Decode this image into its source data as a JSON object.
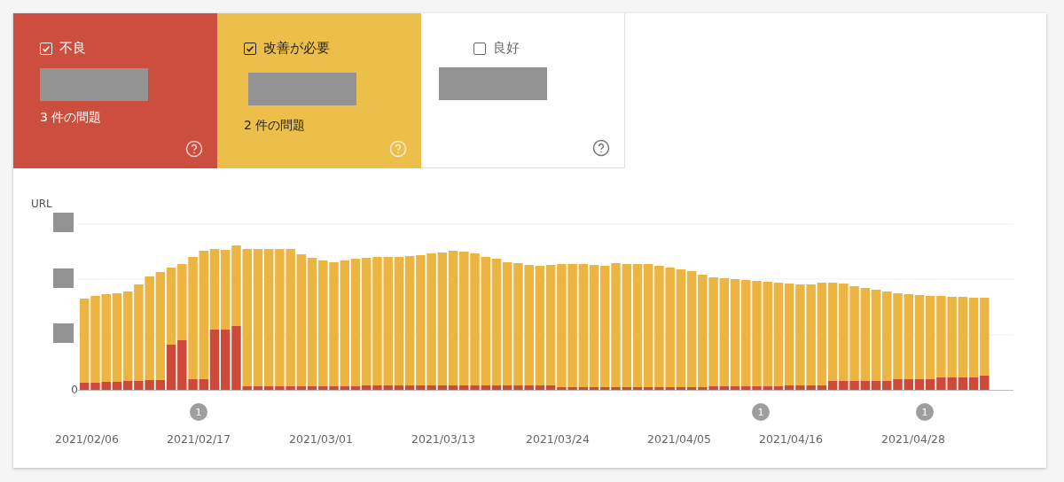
{
  "status_tiles": [
    {
      "kind": "poor",
      "color": "#cb4e3e",
      "label": "不良",
      "checked": true,
      "issues": "3 件の問題"
    },
    {
      "kind": "needs_improvement",
      "color": "#ecbf4b",
      "label": "改善が必要",
      "checked": true,
      "issues": "2 件の問題"
    },
    {
      "kind": "good",
      "color": "#ffffff",
      "label": "良好",
      "checked": false
    }
  ],
  "chart": {
    "y_axis_label": "URL",
    "zero_label": "0",
    "annotations": [
      {
        "label": "1"
      },
      {
        "label": "1"
      },
      {
        "label": "1"
      }
    ],
    "dates": [
      "2021/02/06",
      "2021/02/17",
      "2021/03/01",
      "2021/03/13",
      "2021/03/24",
      "2021/04/05",
      "2021/04/16",
      "2021/04/28"
    ]
  }
}
